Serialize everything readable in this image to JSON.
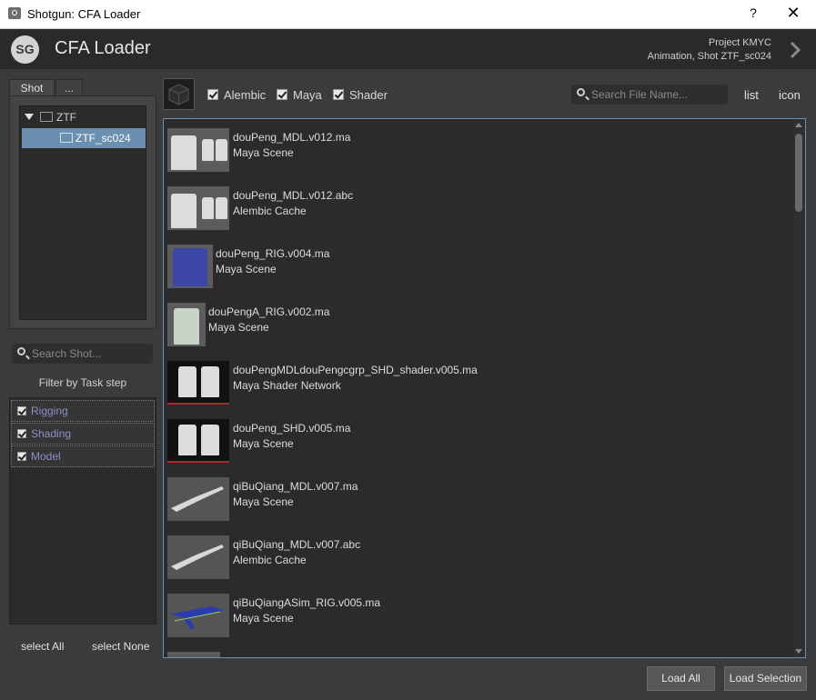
{
  "window": {
    "title": "Shotgun: CFA Loader",
    "help": "?",
    "close": "✕"
  },
  "header": {
    "logo": "SG",
    "app_title": "CFA Loader",
    "project_line": "Project KMYC",
    "context_line": "Animation, Shot ZTF_sc024"
  },
  "left": {
    "tabs": [
      "Shot",
      "..."
    ],
    "tree": {
      "root": "ZTF",
      "child": "ZTF_sc024"
    },
    "shot_search_placeholder": "Search Shot...",
    "filter_label": "Filter by Task step",
    "steps": [
      {
        "label": "Rigging",
        "checked": true
      },
      {
        "label": "Shading",
        "checked": true
      },
      {
        "label": "Model",
        "checked": true
      }
    ],
    "select_all": "select All",
    "select_none": "select None"
  },
  "toolbar": {
    "filters": [
      {
        "label": "Alembic",
        "checked": true
      },
      {
        "label": "Maya",
        "checked": true
      },
      {
        "label": "Shader",
        "checked": true
      }
    ],
    "file_search_placeholder": "Search File Name...",
    "view_list": "list",
    "view_icon": "icon"
  },
  "files": [
    {
      "name": "douPeng_MDL.v012.ma",
      "type": "Maya Scene"
    },
    {
      "name": "douPeng_MDL.v012.abc",
      "type": "Alembic Cache"
    },
    {
      "name": "douPeng_RIG.v004.ma",
      "type": "Maya Scene"
    },
    {
      "name": "douPengA_RIG.v002.ma",
      "type": "Maya Scene"
    },
    {
      "name": "douPengMDLdouPengcgrp_SHD_shader.v005.ma",
      "type": "Maya Shader Network"
    },
    {
      "name": "douPeng_SHD.v005.ma",
      "type": "Maya Scene"
    },
    {
      "name": "qiBuQiang_MDL.v007.ma",
      "type": "Maya Scene"
    },
    {
      "name": "qiBuQiang_MDL.v007.abc",
      "type": "Alembic Cache"
    },
    {
      "name": "qiBuQiangASim_RIG.v005.ma",
      "type": "Maya Scene"
    }
  ],
  "buttons": {
    "load_all": "Load All",
    "load_selection": "Load Selection"
  },
  "colors": {
    "header_bg": "#2a2a2a",
    "panel_bg": "#3b3b3b",
    "selection": "#6a8faf",
    "step_text": "#8b8fc9"
  }
}
